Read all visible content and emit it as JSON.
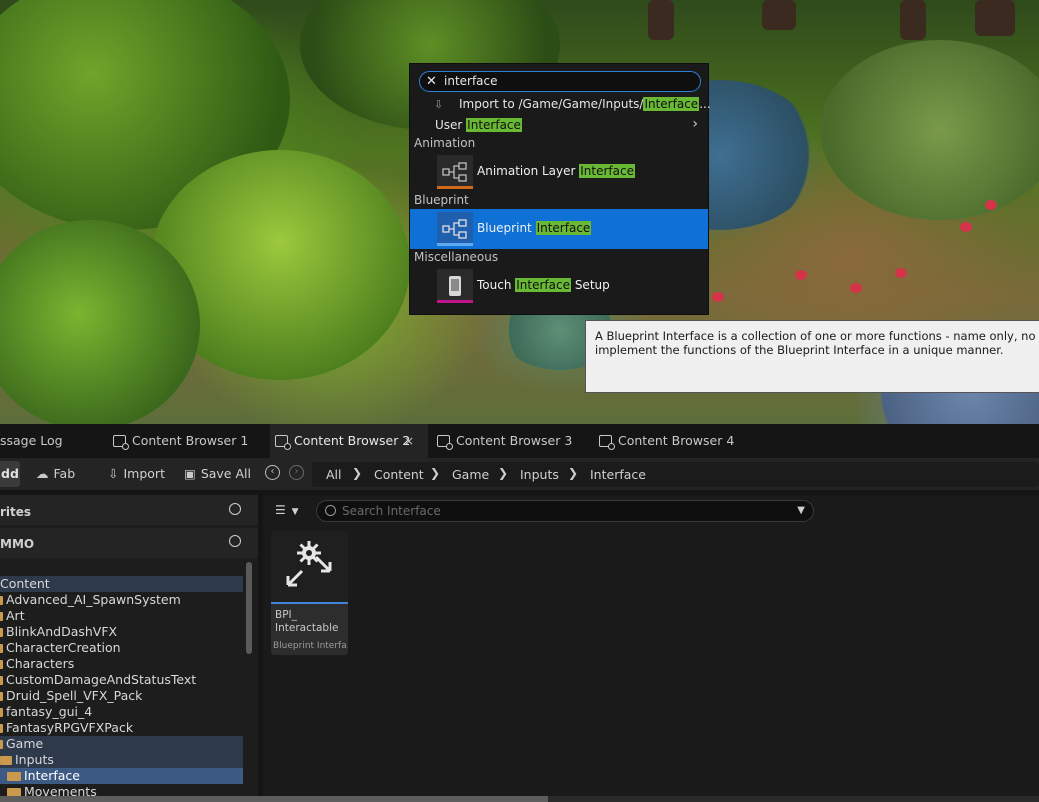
{
  "search": {
    "query": "interface",
    "import_prefix": "Import to /Game/Game/Inputs/",
    "import_highlight": "Interface",
    "import_suffix": "..."
  },
  "menu": {
    "user": {
      "prefix": "User ",
      "highlight": "Interface"
    },
    "sections": [
      {
        "title": "Animation",
        "item": {
          "prefix": "Animation Layer ",
          "highlight": "Interface",
          "suffix": ""
        }
      },
      {
        "title": "Blueprint",
        "item": {
          "prefix": "Blueprint ",
          "highlight": "Interface",
          "suffix": ""
        }
      },
      {
        "title": "Miscellaneous",
        "item": {
          "prefix": "Touch ",
          "highlight": "Interface",
          "suffix": " Setup"
        }
      }
    ]
  },
  "tooltip": {
    "line1": "A Blueprint Interface is a collection of one or more functions - name only, no implem",
    "line2": "implement the functions of the Blueprint Interface in a unique manner."
  },
  "tabs": [
    "ssage Log",
    "Content Browser 1",
    "Content Browser 2",
    "Content Browser 3",
    "Content Browser 4"
  ],
  "tab_close": "×",
  "toolbar": {
    "add": "dd",
    "fab": "Fab",
    "import": "Import",
    "save_all": "Save All"
  },
  "breadcrumb": [
    "All",
    "Content",
    "Game",
    "Inputs",
    "Interface"
  ],
  "left_panel": {
    "favorites": "rites",
    "project": "MMO",
    "tree": [
      "Content",
      "Advanced_AI_SpawnSystem",
      "Art",
      "BlinkAndDashVFX",
      "CharacterCreation",
      "Characters",
      "CustomDamageAndStatusText",
      "Druid_Spell_VFX_Pack",
      "fantasy_gui_4",
      "FantasyRPGVFXPack",
      "Game",
      "Inputs",
      "Interface",
      "Movements"
    ]
  },
  "asset_search": {
    "placeholder": "Search Interface"
  },
  "asset": {
    "name_line1": "BPI_",
    "name_line2": "Interactable",
    "type": "Blueprint Interfa..."
  },
  "colors": {
    "highlight": "#6ab935",
    "selection": "#0f70d6",
    "animation_bar": "#d06a1a",
    "misc_bar": "#c0148a",
    "tree_selected": "#3d5a85"
  }
}
